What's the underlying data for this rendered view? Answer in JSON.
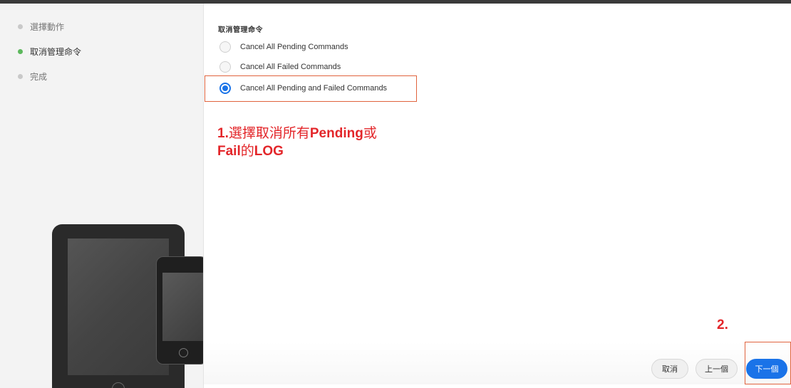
{
  "sidebar": {
    "steps": [
      {
        "label": "選擇動作"
      },
      {
        "label": "取消管理命令"
      },
      {
        "label": "完成"
      }
    ]
  },
  "main": {
    "section_title": "取消管理命令",
    "options": [
      {
        "label": "Cancel All Pending Commands",
        "selected": false
      },
      {
        "label": "Cancel All Failed Commands",
        "selected": false
      },
      {
        "label": "Cancel All Pending and Failed Commands",
        "selected": true
      }
    ]
  },
  "annotations": {
    "step1_prefix": "1.",
    "step1_a": "選擇取消所有",
    "step1_b": "Pending",
    "step1_c": "或",
    "step1_d": "Fail",
    "step1_e": "的",
    "step1_f": "LOG",
    "step2": "2."
  },
  "footer": {
    "cancel_label": "取消",
    "back_label": "上一個",
    "next_label": "下一個"
  },
  "colors": {
    "accent": "#1a73e8",
    "active_step": "#5cb85c",
    "annotation": "#e3262a",
    "highlight_border": "#e0633d"
  }
}
